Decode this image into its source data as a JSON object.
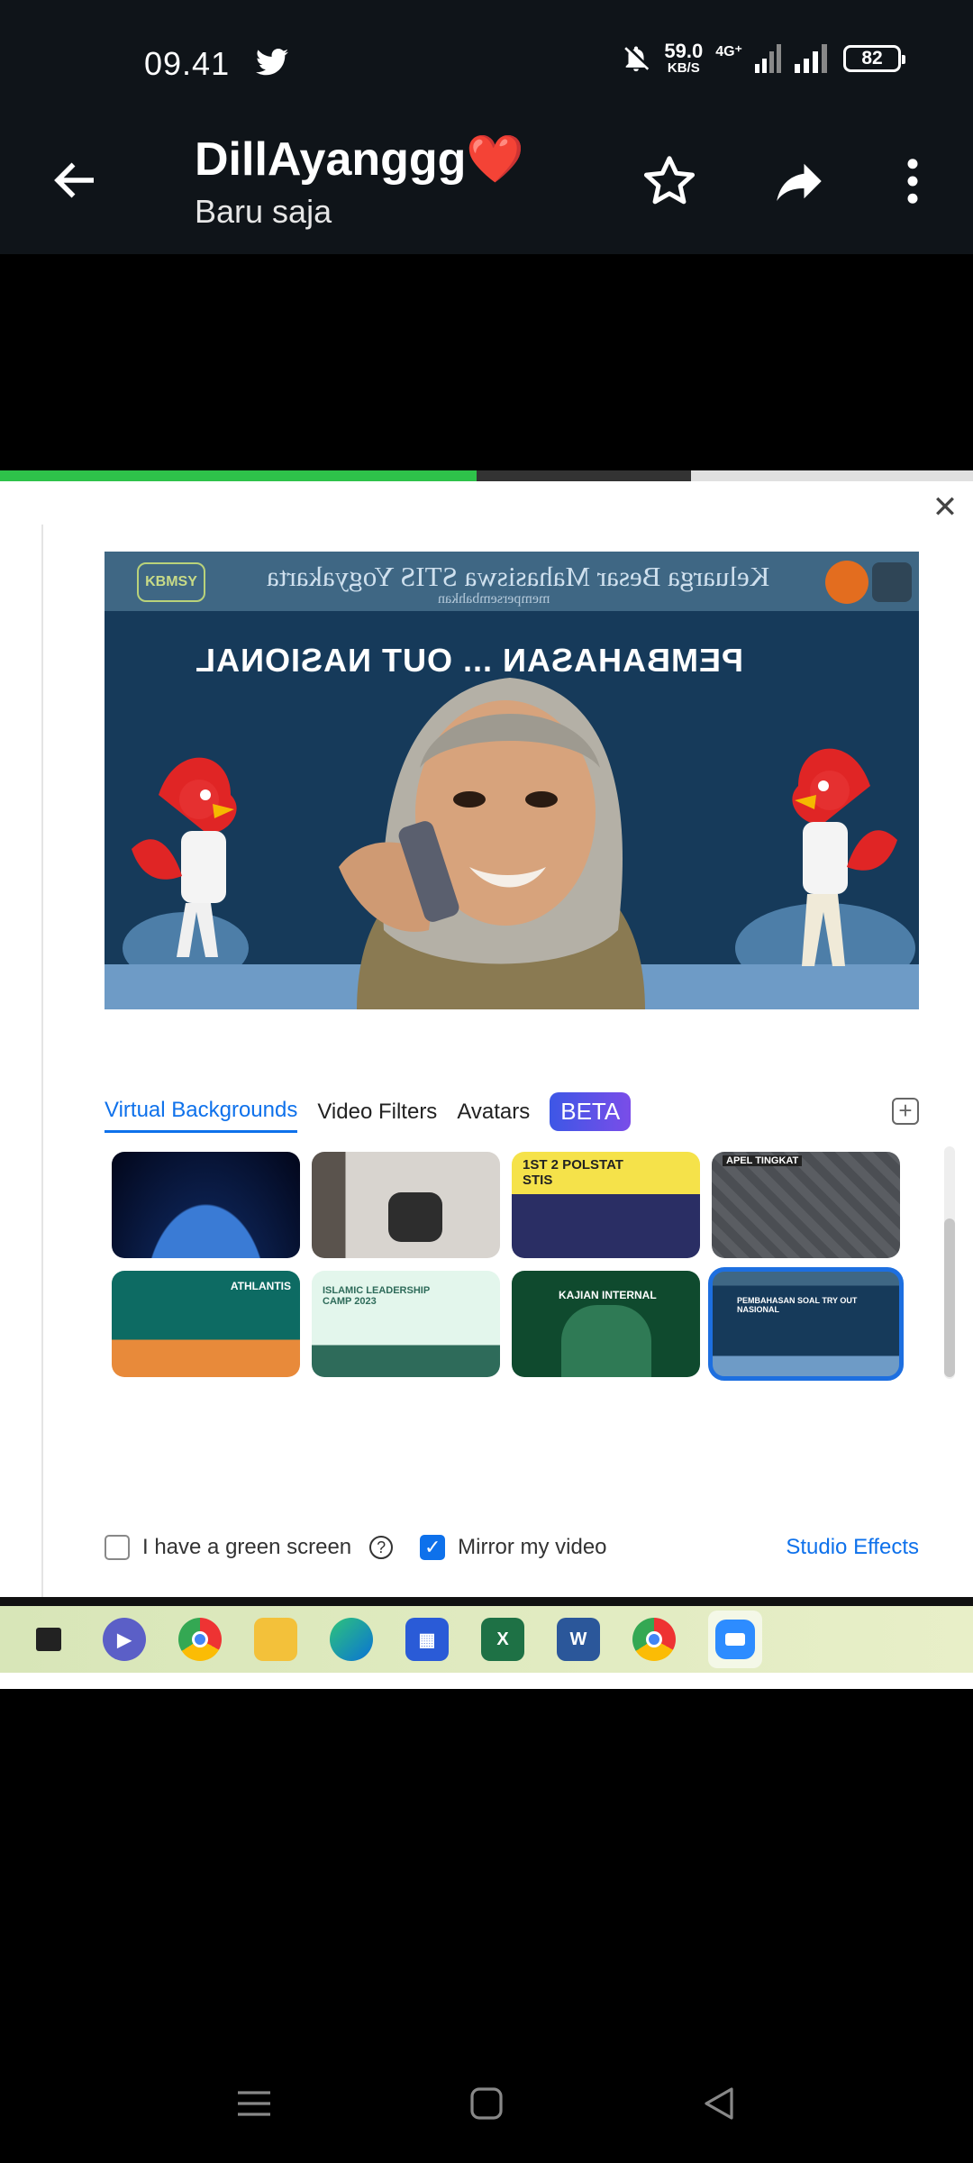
{
  "status_bar": {
    "time": "09.41",
    "speed_value": "59.0",
    "speed_unit": "KB/S",
    "network": "4G⁺",
    "battery": "82"
  },
  "header": {
    "title": "DillAyanggg❤️",
    "subtitle": "Baru saja"
  },
  "player": {
    "progress": 0.49,
    "buffered": 0.71
  },
  "preview": {
    "org_text": "Keluarga Besar Mahasiswa STIS Yogyakarta",
    "tagline": "mempersembahkan",
    "banner_text": "PEMBAHASAN ... OUT NASIONAL",
    "logo_text": "KBMSY"
  },
  "tabs": {
    "virtual_backgrounds": "Virtual Backgrounds",
    "video_filters": "Video Filters",
    "avatars": "Avatars",
    "beta": "BETA"
  },
  "thumbnails": [
    {
      "label": "",
      "theme": "earth"
    },
    {
      "label": "",
      "theme": "room"
    },
    {
      "label": "1ST 2 POLSTAT STIS",
      "theme": "yellow"
    },
    {
      "label": "APEL TINGKAT",
      "theme": "gray"
    },
    {
      "label": "ATHLANTIS",
      "theme": "sea"
    },
    {
      "label": "ISLAMIC LEADERSHIP CAMP 2023",
      "theme": "mosque"
    },
    {
      "label": "KAJIAN INTERNAL",
      "theme": "green"
    },
    {
      "label": "PEMBAHASAN SOAL TRY OUT NASIONAL",
      "theme": "blue",
      "selected": true
    }
  ],
  "controls": {
    "green_screen": "I have a green screen",
    "mirror": "Mirror my video",
    "studio_effects": "Studio Effects"
  },
  "taskbar": [
    "explorer",
    "zoom-meet",
    "chrome",
    "files",
    "edge",
    "store",
    "excel",
    "word",
    "chrome-profile",
    "zoom"
  ]
}
